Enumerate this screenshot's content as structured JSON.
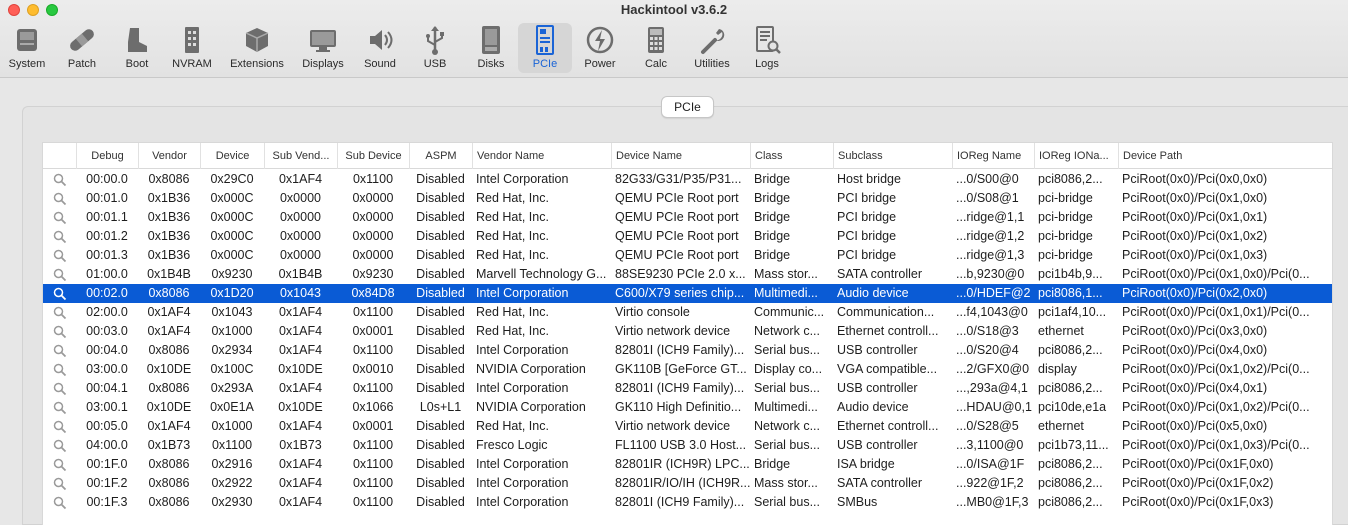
{
  "window": {
    "title": "Hackintool v3.6.2"
  },
  "toolbar": [
    {
      "label": "System",
      "icon": "system-icon"
    },
    {
      "label": "Patch",
      "icon": "bandage-icon"
    },
    {
      "label": "Boot",
      "icon": "boot-icon"
    },
    {
      "label": "NVRAM",
      "icon": "nvram-icon"
    },
    {
      "label": "Extensions",
      "icon": "extensions-icon"
    },
    {
      "label": "Displays",
      "icon": "display-icon"
    },
    {
      "label": "Sound",
      "icon": "speaker-icon"
    },
    {
      "label": "USB",
      "icon": "usb-icon"
    },
    {
      "label": "Disks",
      "icon": "disk-icon"
    },
    {
      "label": "PCIe",
      "icon": "pcie-icon"
    },
    {
      "label": "Power",
      "icon": "power-icon"
    },
    {
      "label": "Calc",
      "icon": "calculator-icon"
    },
    {
      "label": "Utilities",
      "icon": "wrench-icon"
    },
    {
      "label": "Logs",
      "icon": "logs-icon"
    }
  ],
  "panel": {
    "tab_label": "PCIe"
  },
  "table": {
    "columns": [
      "",
      "Debug",
      "Vendor",
      "Device",
      "Sub Vend...",
      "Sub Device",
      "ASPM",
      "Vendor Name",
      "Device Name",
      "Class",
      "Subclass",
      "IOReg Name",
      "IOReg IONa...",
      "Device Path"
    ],
    "selected_row": 6,
    "rows": [
      [
        "00:00.0",
        "0x8086",
        "0x29C0",
        "0x1AF4",
        "0x1100",
        "Disabled",
        "Intel Corporation",
        "82G33/G31/P35/P31...",
        "Bridge",
        "Host bridge",
        "...0/S00@0",
        "pci8086,2...",
        "PciRoot(0x0)/Pci(0x0,0x0)"
      ],
      [
        "00:01.0",
        "0x1B36",
        "0x000C",
        "0x0000",
        "0x0000",
        "Disabled",
        "Red Hat, Inc.",
        "QEMU PCIe Root port",
        "Bridge",
        "PCI bridge",
        "...0/S08@1",
        "pci-bridge",
        "PciRoot(0x0)/Pci(0x1,0x0)"
      ],
      [
        "00:01.1",
        "0x1B36",
        "0x000C",
        "0x0000",
        "0x0000",
        "Disabled",
        "Red Hat, Inc.",
        "QEMU PCIe Root port",
        "Bridge",
        "PCI bridge",
        "...ridge@1,1",
        "pci-bridge",
        "PciRoot(0x0)/Pci(0x1,0x1)"
      ],
      [
        "00:01.2",
        "0x1B36",
        "0x000C",
        "0x0000",
        "0x0000",
        "Disabled",
        "Red Hat, Inc.",
        "QEMU PCIe Root port",
        "Bridge",
        "PCI bridge",
        "...ridge@1,2",
        "pci-bridge",
        "PciRoot(0x0)/Pci(0x1,0x2)"
      ],
      [
        "00:01.3",
        "0x1B36",
        "0x000C",
        "0x0000",
        "0x0000",
        "Disabled",
        "Red Hat, Inc.",
        "QEMU PCIe Root port",
        "Bridge",
        "PCI bridge",
        "...ridge@1,3",
        "pci-bridge",
        "PciRoot(0x0)/Pci(0x1,0x3)"
      ],
      [
        "01:00.0",
        "0x1B4B",
        "0x9230",
        "0x1B4B",
        "0x9230",
        "Disabled",
        "Marvell Technology G...",
        "88SE9230 PCIe 2.0 x...",
        "Mass stor...",
        "SATA controller",
        "...b,9230@0",
        "pci1b4b,9...",
        "PciRoot(0x0)/Pci(0x1,0x0)/Pci(0..."
      ],
      [
        "00:02.0",
        "0x8086",
        "0x1D20",
        "0x1043",
        "0x84D8",
        "Disabled",
        "Intel Corporation",
        "C600/X79 series chip...",
        "Multimedi...",
        "Audio device",
        "...0/HDEF@2",
        "pci8086,1...",
        "PciRoot(0x0)/Pci(0x2,0x0)"
      ],
      [
        "02:00.0",
        "0x1AF4",
        "0x1043",
        "0x1AF4",
        "0x1100",
        "Disabled",
        "Red Hat, Inc.",
        "Virtio console",
        "Communic...",
        "Communication...",
        "...f4,1043@0",
        "pci1af4,10...",
        "PciRoot(0x0)/Pci(0x1,0x1)/Pci(0..."
      ],
      [
        "00:03.0",
        "0x1AF4",
        "0x1000",
        "0x1AF4",
        "0x0001",
        "Disabled",
        "Red Hat, Inc.",
        "Virtio network device",
        "Network c...",
        "Ethernet controll...",
        "...0/S18@3",
        "ethernet",
        "PciRoot(0x0)/Pci(0x3,0x0)"
      ],
      [
        "00:04.0",
        "0x8086",
        "0x2934",
        "0x1AF4",
        "0x1100",
        "Disabled",
        "Intel Corporation",
        "82801I (ICH9 Family)...",
        "Serial bus...",
        "USB controller",
        "...0/S20@4",
        "pci8086,2...",
        "PciRoot(0x0)/Pci(0x4,0x0)"
      ],
      [
        "03:00.0",
        "0x10DE",
        "0x100C",
        "0x10DE",
        "0x0010",
        "Disabled",
        "NVIDIA Corporation",
        "GK110B [GeForce GT...",
        "Display co...",
        "VGA compatible...",
        "...2/GFX0@0",
        "display",
        "PciRoot(0x0)/Pci(0x1,0x2)/Pci(0..."
      ],
      [
        "00:04.1",
        "0x8086",
        "0x293A",
        "0x1AF4",
        "0x1100",
        "Disabled",
        "Intel Corporation",
        "82801I (ICH9 Family)...",
        "Serial bus...",
        "USB controller",
        "...,293a@4,1",
        "pci8086,2...",
        "PciRoot(0x0)/Pci(0x4,0x1)"
      ],
      [
        "03:00.1",
        "0x10DE",
        "0x0E1A",
        "0x10DE",
        "0x1066",
        "L0s+L1",
        "NVIDIA Corporation",
        "GK110 High Definitio...",
        "Multimedi...",
        "Audio device",
        "...HDAU@0,1",
        "pci10de,e1a",
        "PciRoot(0x0)/Pci(0x1,0x2)/Pci(0..."
      ],
      [
        "00:05.0",
        "0x1AF4",
        "0x1000",
        "0x1AF4",
        "0x0001",
        "Disabled",
        "Red Hat, Inc.",
        "Virtio network device",
        "Network c...",
        "Ethernet controll...",
        "...0/S28@5",
        "ethernet",
        "PciRoot(0x0)/Pci(0x5,0x0)"
      ],
      [
        "04:00.0",
        "0x1B73",
        "0x1100",
        "0x1B73",
        "0x1100",
        "Disabled",
        "Fresco Logic",
        "FL1100 USB 3.0 Host...",
        "Serial bus...",
        "USB controller",
        "...3,1100@0",
        "pci1b73,11...",
        "PciRoot(0x0)/Pci(0x1,0x3)/Pci(0..."
      ],
      [
        "00:1F.0",
        "0x8086",
        "0x2916",
        "0x1AF4",
        "0x1100",
        "Disabled",
        "Intel Corporation",
        "82801IR (ICH9R) LPC...",
        "Bridge",
        "ISA bridge",
        "...0/ISA@1F",
        "pci8086,2...",
        "PciRoot(0x0)/Pci(0x1F,0x0)"
      ],
      [
        "00:1F.2",
        "0x8086",
        "0x2922",
        "0x1AF4",
        "0x1100",
        "Disabled",
        "Intel Corporation",
        "82801IR/IO/IH (ICH9R...",
        "Mass stor...",
        "SATA controller",
        "...922@1F,2",
        "pci8086,2...",
        "PciRoot(0x0)/Pci(0x1F,0x2)"
      ],
      [
        "00:1F.3",
        "0x8086",
        "0x2930",
        "0x1AF4",
        "0x1100",
        "Disabled",
        "Intel Corporation",
        "82801I (ICH9 Family)...",
        "Serial bus...",
        "SMBus",
        "...MB0@1F,3",
        "pci8086,2...",
        "PciRoot(0x0)/Pci(0x1F,0x3)"
      ]
    ]
  },
  "colors": {
    "selection": "#0a5bd5",
    "accent": "#1a64d6"
  }
}
